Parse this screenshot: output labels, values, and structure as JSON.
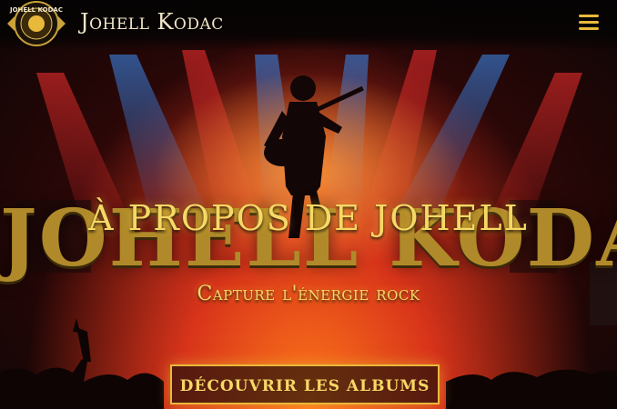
{
  "header": {
    "logo_text": "JOHELL KODAC",
    "site_title": "Johell Kodac",
    "menu_icon": "hamburger-icon"
  },
  "hero": {
    "background_name": "JOHELL KODAC",
    "heading": "À PROPOS DE JOHELL",
    "tagline": "Capture l'énergie rock",
    "cta_label": "DÉCOUVRIR LES ALBUMS"
  },
  "colors": {
    "accent": "#e8b93a",
    "heading_gold": "#f6d866",
    "title_cream": "#f1e6c8",
    "background_dark": "#0b0606"
  }
}
